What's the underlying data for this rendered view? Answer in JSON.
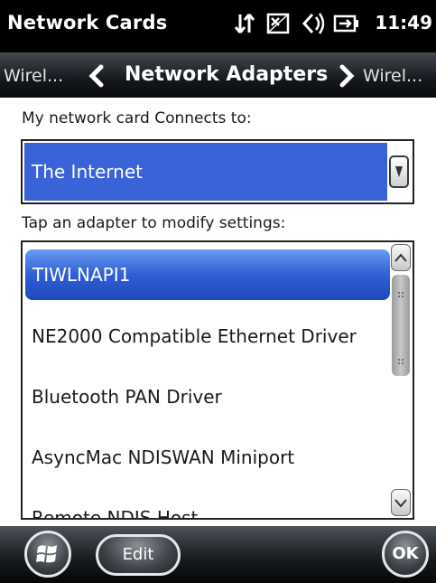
{
  "titlebar": {
    "title": "Network Cards",
    "time": "11:49",
    "status_icons": [
      "connectivity-icon",
      "no-signal-icon",
      "speaker-icon",
      "battery-icon"
    ]
  },
  "navbar": {
    "prev_label": "Wirel...",
    "current_label": "Network Adapters",
    "next_label": "Wirel..."
  },
  "connects": {
    "label": "My network card Connects to:",
    "selected_value": "The Internet"
  },
  "adapters": {
    "label": "Tap an adapter to modify settings:",
    "items": [
      "TIWLNAPI1",
      "NE2000 Compatible Ethernet Driver",
      "Bluetooth PAN Driver",
      "AsyncMac NDISWAN Miniport",
      "Remote NDIS Host"
    ],
    "selected_index": 0
  },
  "menubar": {
    "edit_label": "Edit",
    "ok_label": "OK"
  },
  "colors": {
    "selection": "#3b63d8",
    "bar_dark": "#000000",
    "text": "#1a1a1a"
  }
}
